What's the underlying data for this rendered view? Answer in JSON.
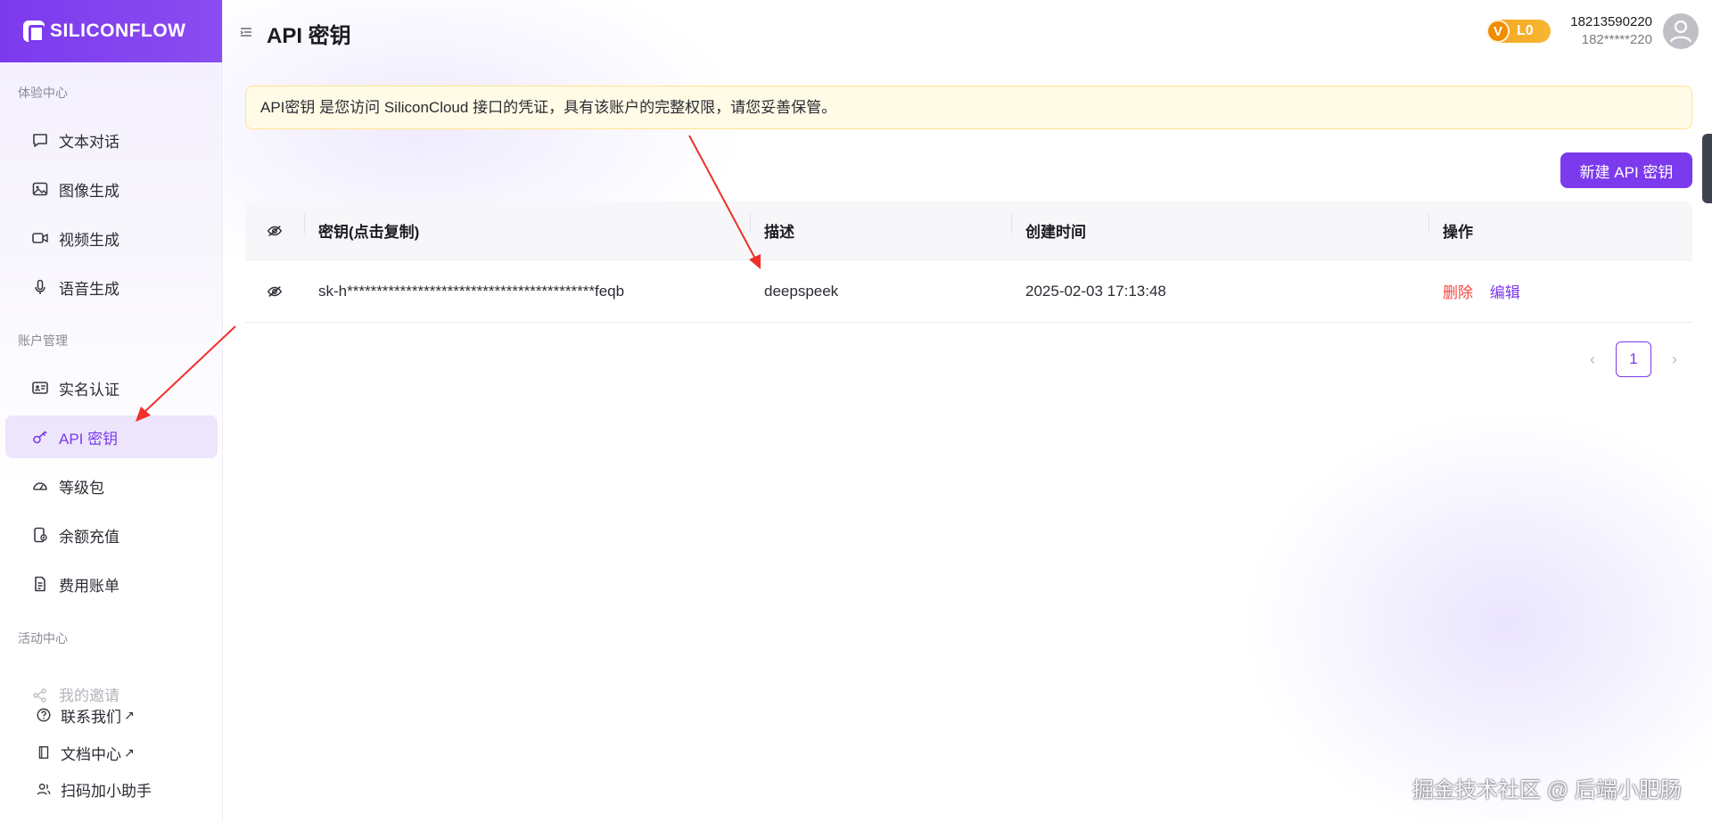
{
  "brand": {
    "name": "SILICONFLOW"
  },
  "sidebar": {
    "groups": [
      {
        "label": "体验中心"
      },
      {
        "label": "账户管理"
      },
      {
        "label": "活动中心"
      }
    ],
    "items": [
      {
        "label": "文本对话",
        "icon": "chat-bubble-icon"
      },
      {
        "label": "图像生成",
        "icon": "image-icon"
      },
      {
        "label": "视频生成",
        "icon": "video-icon"
      },
      {
        "label": "语音生成",
        "icon": "microphone-icon"
      },
      {
        "label": "实名认证",
        "icon": "id-card-icon"
      },
      {
        "label": "API 密钥",
        "icon": "key-icon",
        "active": true
      },
      {
        "label": "等级包",
        "icon": "gauge-icon"
      },
      {
        "label": "余额充值",
        "icon": "wallet-icon"
      },
      {
        "label": "费用账单",
        "icon": "bill-icon"
      },
      {
        "label": "我的邀请",
        "icon": "share-icon"
      }
    ],
    "footer": [
      {
        "label": "联系我们",
        "ext": "↗"
      },
      {
        "label": "文档中心",
        "ext": "↗"
      },
      {
        "label": "扫码加小助手"
      }
    ]
  },
  "header": {
    "title": "API 密钥",
    "level_badge": "L0",
    "level_badge_mark": "V",
    "user_name": "18213590220",
    "user_masked": "182*****220"
  },
  "notice": {
    "text": "API密钥 是您访问 SiliconCloud 接口的凭证，具有该账户的完整权限，请您妥善保管。"
  },
  "actions": {
    "new_key_button": "新建 API 密钥"
  },
  "table": {
    "columns": [
      "密钥(点击复制)",
      "描述",
      "创建时间",
      "操作"
    ],
    "rows": [
      {
        "key": "sk-h******************************************feqb",
        "description": "deepspeek",
        "created": "2025-02-03 17:13:48",
        "delete_label": "删除",
        "edit_label": "编辑"
      }
    ]
  },
  "pagination": {
    "current": "1",
    "prev": "‹",
    "next": "›"
  },
  "watermark": "掘金技术社区 @ 后端小肥肠",
  "colors": {
    "accent": "#7c3aed",
    "danger": "#f5453f",
    "notice_bg": "#fffbe6",
    "badge": "#f5a623"
  }
}
